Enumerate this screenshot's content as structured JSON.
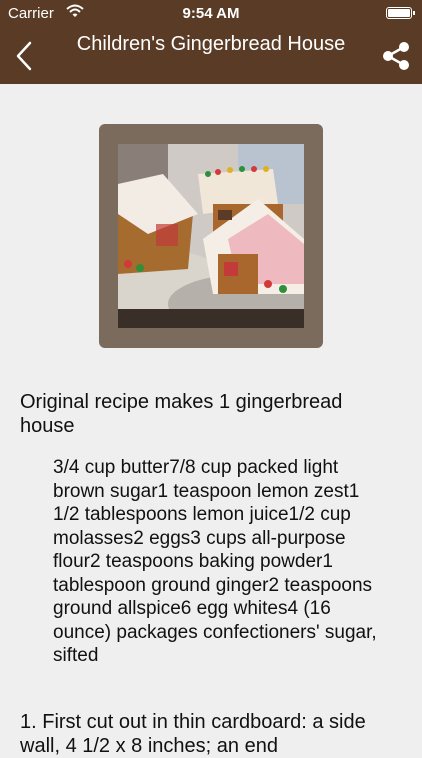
{
  "status_bar": {
    "carrier": "Carrier",
    "time": "9:54 AM"
  },
  "nav": {
    "title": "Children's Gingerbread House"
  },
  "recipe": {
    "intro": "Original recipe makes 1 gingerbread house",
    "ingredients": "3/4 cup butter7/8 cup packed light brown sugar1 teaspoon lemon zest1 1/2 tablespoons lemon juice1/2 cup molasses2 eggs3 cups all-purpose flour2 teaspoons baking powder1 tablespoon ground ginger2 teaspoons ground allspice6 egg whites4 (16 ounce) packages confectioners' sugar, sifted",
    "step1": "1. First cut out in thin cardboard: a side wall, 4 1/2 x 8 inches; an end"
  },
  "colors": {
    "nav_bg": "#5a3b26",
    "page_bg": "#efefef",
    "frame": "#7b6b5d"
  },
  "icons": {
    "back": "chevron-left-icon",
    "share": "share-icon",
    "wifi": "wifi-icon",
    "battery": "battery-icon"
  }
}
